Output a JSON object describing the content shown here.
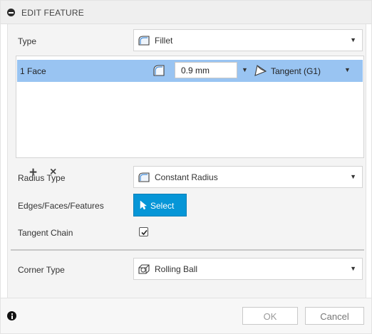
{
  "header": {
    "title": "EDIT FEATURE"
  },
  "type_row": {
    "label": "Type",
    "value": "Fillet",
    "icon": "fillet-icon"
  },
  "selection": {
    "row": {
      "label": "1 Face",
      "radius_value": "0.9 mm",
      "continuity": "Tangent (G1)",
      "radius_icon": "radius-icon",
      "continuity_icon": "tangent-icon"
    },
    "add_symbol": "+",
    "remove_symbol": "×"
  },
  "radius_type": {
    "label": "Radius Type",
    "value": "Constant Radius",
    "icon": "constant-radius-icon"
  },
  "edges": {
    "label": "Edges/Faces/Features",
    "button_label": "Select",
    "icon": "cursor-icon"
  },
  "tangent_chain": {
    "label": "Tangent Chain",
    "checked": true
  },
  "corner_type": {
    "label": "Corner Type",
    "value": "Rolling Ball",
    "icon": "rolling-ball-icon"
  },
  "footer": {
    "ok_label": "OK",
    "cancel_label": "Cancel",
    "info_icon": "info-icon"
  },
  "colors": {
    "selected_row": "#99c4f2",
    "select_button": "#0696d7",
    "header_bg": "#efefef"
  }
}
